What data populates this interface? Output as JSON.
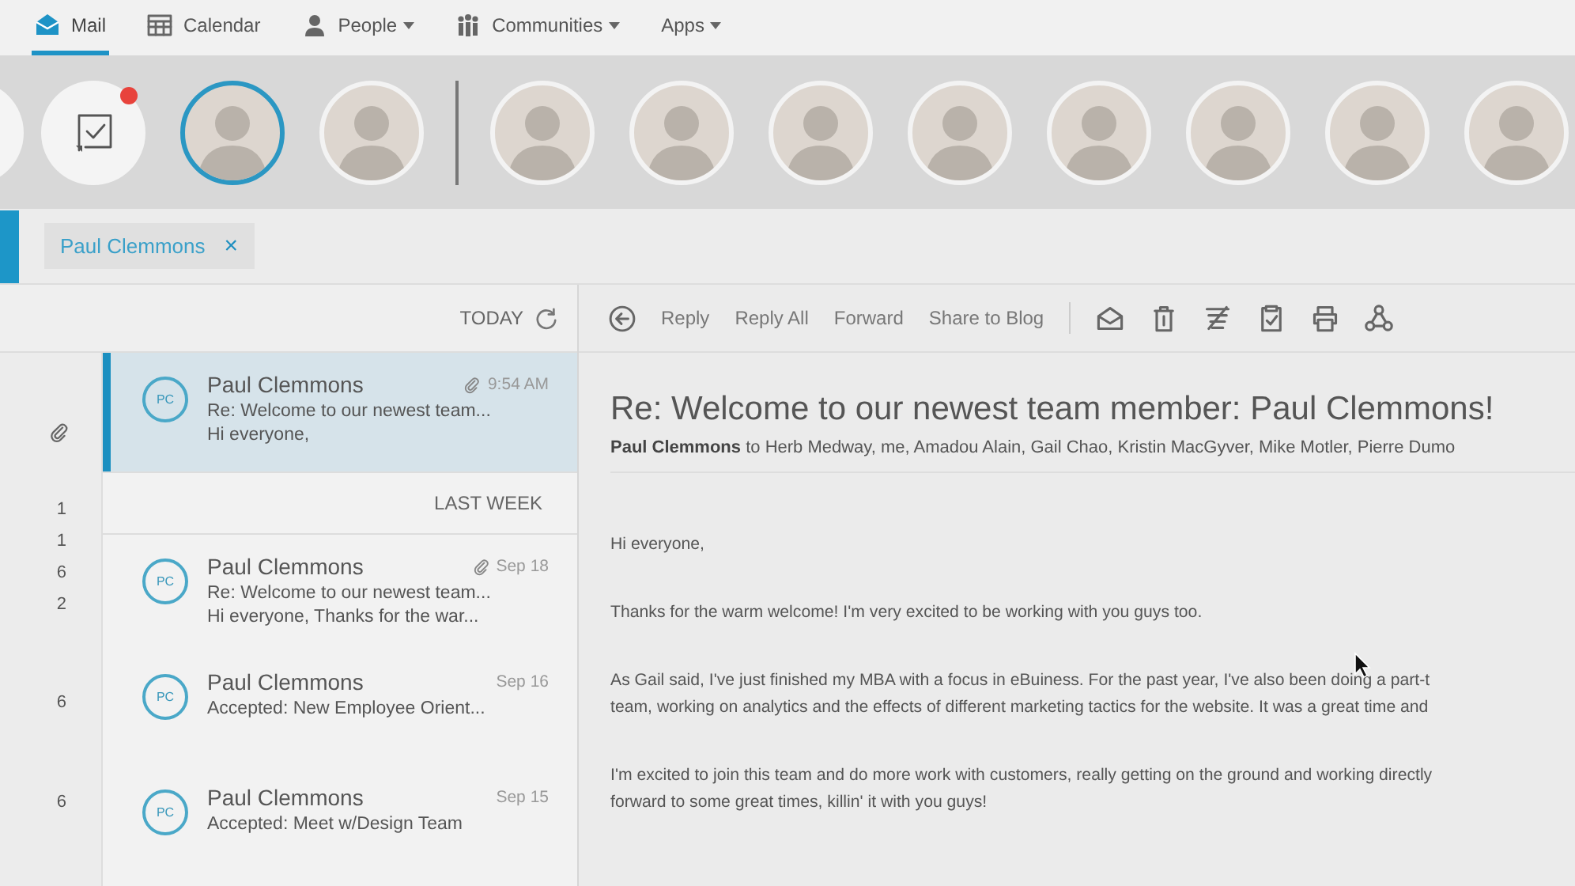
{
  "nav_tabs": [
    {
      "kind": "mail",
      "label": "Mail",
      "selected": true,
      "dropdown": false
    },
    {
      "kind": "calendar",
      "label": "Calendar",
      "selected": false,
      "dropdown": false
    },
    {
      "kind": "person",
      "label": "People",
      "selected": false,
      "dropdown": true
    },
    {
      "kind": "group",
      "label": "Communities",
      "selected": false,
      "dropdown": true
    },
    {
      "kind": "none",
      "label": "Apps",
      "selected": false,
      "dropdown": true
    }
  ],
  "people_strip": {
    "tasks": {
      "notification": true
    },
    "pinned": [
      {
        "selected": true
      },
      {
        "selected": false
      }
    ],
    "people": [
      {
        "selected": false
      },
      {
        "selected": false
      },
      {
        "selected": false
      },
      {
        "selected": false
      },
      {
        "selected": false
      },
      {
        "selected": false
      },
      {
        "selected": false
      },
      {
        "selected": false
      }
    ]
  },
  "filter": {
    "chips": [
      {
        "label": "Paul Clemmons",
        "close": "×"
      }
    ]
  },
  "rail": [
    {
      "kind": "attachment"
    },
    {
      "kind": "count",
      "text": "1"
    },
    {
      "kind": "count",
      "text": "1"
    },
    {
      "kind": "count",
      "text": "6"
    },
    {
      "kind": "count",
      "text": "2"
    },
    {
      "kind": "count",
      "text": "6"
    },
    {
      "kind": "count",
      "text": "6"
    }
  ],
  "message_list": {
    "sections": [
      {
        "heading": "TODAY",
        "refresh": true,
        "messages": [
          {
            "initials": "PC",
            "sender": "Paul Clemmons",
            "time": "9:54 AM",
            "attachment": true,
            "subject": "Re: Welcome to our newest team...",
            "preview": "Hi everyone,",
            "selected": true
          }
        ]
      },
      {
        "heading": "LAST WEEK",
        "refresh": false,
        "messages": [
          {
            "initials": "PC",
            "sender": "Paul Clemmons",
            "time": "Sep 18",
            "attachment": true,
            "subject": "Re: Welcome to our newest team...",
            "preview": "Hi everyone, Thanks for the war...",
            "selected": false
          },
          {
            "initials": "PC",
            "sender": "Paul Clemmons",
            "time": "Sep 16",
            "attachment": false,
            "subject": "Accepted: New Employee Orient...",
            "selected": false
          },
          {
            "initials": "PC",
            "sender": "Paul Clemmons",
            "time": "Sep 15",
            "attachment": false,
            "subject": "Accepted: Meet w/Design Team",
            "selected": false
          }
        ]
      }
    ]
  },
  "reading_pane": {
    "toolbar": {
      "actions": [
        "Reply",
        "Reply All",
        "Forward",
        "Share to Blog"
      ],
      "icons": [
        {
          "kind": "envelope-open"
        },
        {
          "kind": "trash"
        },
        {
          "kind": "filter"
        },
        {
          "kind": "clipboard"
        },
        {
          "kind": "printer"
        },
        {
          "kind": "share"
        }
      ]
    },
    "subject": "Re: Welcome to our newest team member: Paul Clemmons!",
    "recipients": "**Paul Clemmons** to Herb Medway, me, Amadou Alain, Gail Chao, Kristin MacGyver, Mike Motler, Pierre Dumo",
    "body": [
      [
        "Hi everyone,"
      ],
      [
        "Thanks for the warm welcome! I'm very excited to be working with you guys too."
      ],
      [
        "As Gail said, I've just finished my MBA with a focus in eBuiness. For the past year, I've also been doing a part-t",
        "team, working on analytics and the effects of different marketing tactics for the website. It was a great time and"
      ],
      [
        "I'm excited to join this team and do more work with customers, really getting on the ground and working directly",
        "forward to some great times, killin' it with you guys!"
      ]
    ]
  }
}
